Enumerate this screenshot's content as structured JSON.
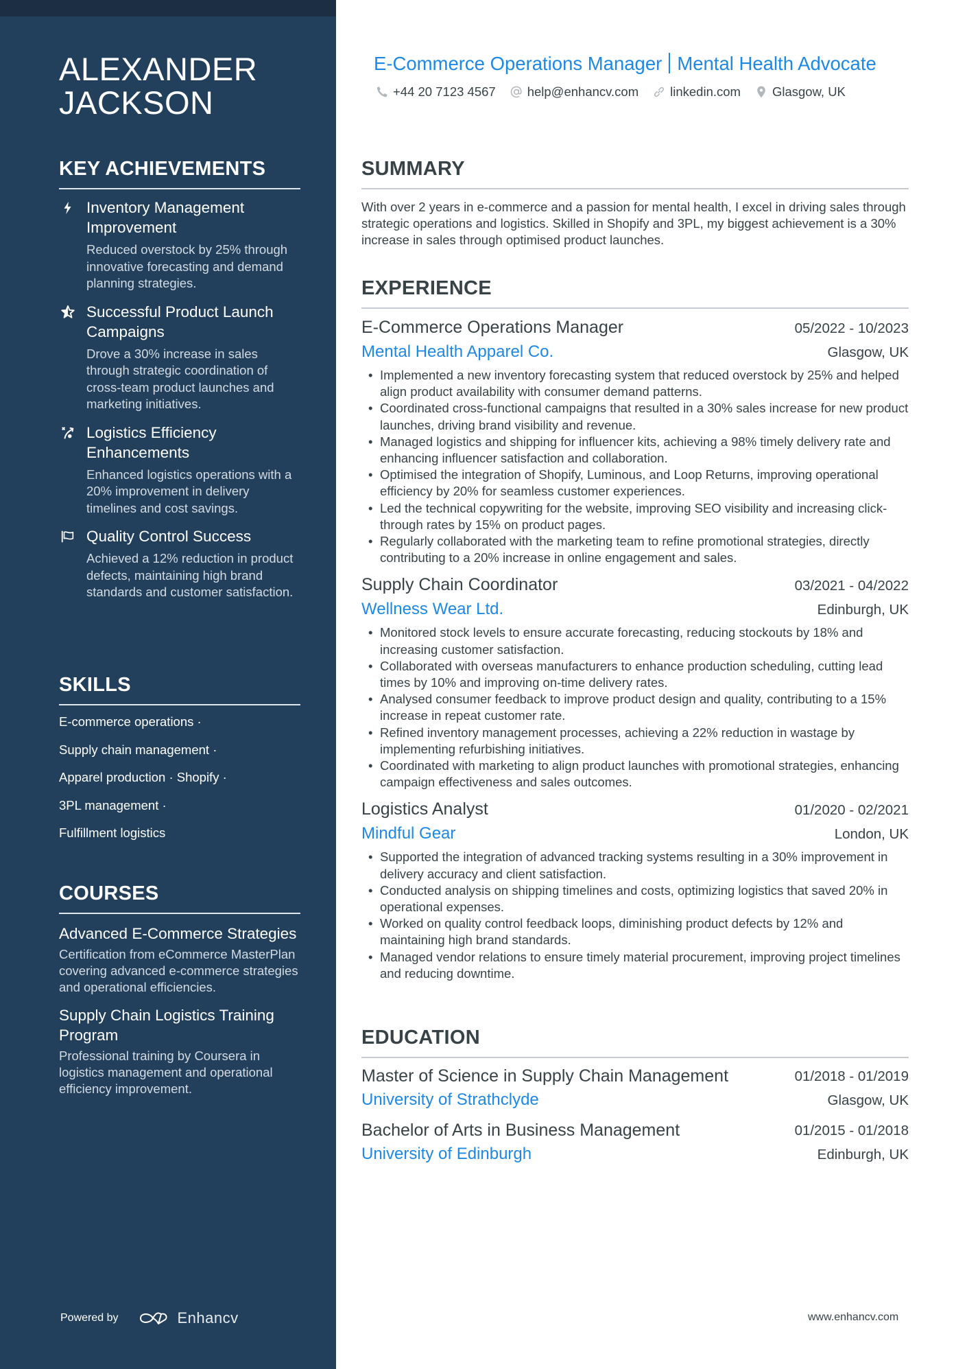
{
  "colors": {
    "sidebar_bg": "#223f5b",
    "sidebar_band": "#1b2e44",
    "accent": "#1e88e5",
    "text": "#384347"
  },
  "person": {
    "name_line1": "ALEXANDER",
    "name_line2": "JACKSON",
    "headline_part1": "E-Commerce Operations Manager",
    "headline_part2": "Mental Health Advocate"
  },
  "contact": {
    "phone": {
      "icon": "phone-icon",
      "text": "+44 20 7123 4567"
    },
    "email": {
      "icon": "at-icon",
      "text": "help@enhancv.com"
    },
    "linkedin": {
      "icon": "link-icon",
      "text": "linkedin.com"
    },
    "location": {
      "icon": "map-pin-icon",
      "text": "Glasgow, UK"
    }
  },
  "sidebar": {
    "achievements": {
      "title": "KEY ACHIEVEMENTS",
      "items": [
        {
          "icon": "lightning-bolt-icon",
          "title": "Inventory Management Improvement",
          "desc": "Reduced overstock by 25% through innovative forecasting and demand planning strategies."
        },
        {
          "icon": "star-icon",
          "title": "Successful Product Launch Campaigns",
          "desc": "Drove a 30% increase in sales through strategic coordination of cross-team product launches and marketing initiatives."
        },
        {
          "icon": "route-icon",
          "title": "Logistics Efficiency Enhancements",
          "desc": "Enhanced logistics operations with a 20% improvement in delivery timelines and cost savings."
        },
        {
          "icon": "flag-icon",
          "title": "Quality Control Success",
          "desc": "Achieved a 12% reduction in product defects, maintaining high brand standards and customer satisfaction."
        }
      ]
    },
    "skills": {
      "title": "SKILLS",
      "lines": [
        "E-commerce operations ·",
        "Supply chain management ·",
        "Apparel production · Shopify ·",
        "3PL management ·",
        "Fulfillment logistics"
      ]
    },
    "courses": {
      "title": "COURSES",
      "items": [
        {
          "title": "Advanced E-Commerce Strategies",
          "desc": "Certification from eCommerce MasterPlan covering advanced e-commerce strategies and operational efficiencies."
        },
        {
          "title": "Supply Chain Logistics Training Program",
          "desc": "Professional training by Coursera in logistics management and operational efficiency improvement."
        }
      ]
    },
    "powered_by": "Powered by",
    "brand": "Enhancv"
  },
  "summary": {
    "title": "SUMMARY",
    "text": "With over 2 years in e-commerce and a passion for mental health, I excel in driving sales through strategic operations and logistics. Skilled in Shopify and 3PL, my biggest achievement is a 30% increase in sales through optimised product launches."
  },
  "experience": {
    "title": "EXPERIENCE",
    "jobs": [
      {
        "role": "E-Commerce Operations Manager",
        "dates": "05/2022 - 10/2023",
        "company": "Mental Health Apparel Co.",
        "location": "Glasgow, UK",
        "bullets": [
          "Implemented a new inventory forecasting system that reduced overstock by 25% and helped align product availability with consumer demand patterns.",
          "Coordinated cross-functional campaigns that resulted in a 30% sales increase for new product launches, driving brand visibility and revenue.",
          "Managed logistics and shipping for influencer kits, achieving a 98% timely delivery rate and enhancing influencer satisfaction and collaboration.",
          "Optimised the integration of Shopify, Luminous, and Loop Returns, improving operational efficiency by 20% for seamless customer experiences.",
          "Led the technical copywriting for the website, improving SEO visibility and increasing click-through rates by 15% on product pages.",
          "Regularly collaborated with the marketing team to refine promotional strategies, directly contributing to a 20% increase in online engagement and sales."
        ]
      },
      {
        "role": "Supply Chain Coordinator",
        "dates": "03/2021 - 04/2022",
        "company": "Wellness Wear Ltd.",
        "location": "Edinburgh, UK",
        "bullets": [
          "Monitored stock levels to ensure accurate forecasting, reducing stockouts by 18% and increasing customer satisfaction.",
          "Collaborated with overseas manufacturers to enhance production scheduling, cutting lead times by 10% and improving on-time delivery rates.",
          "Analysed consumer feedback to improve product design and quality, contributing to a 15% increase in repeat customer rate.",
          "Refined inventory management processes, achieving a 22% reduction in wastage by implementing refurbishing initiatives.",
          "Coordinated with marketing to align product launches with promotional strategies, enhancing campaign effectiveness and sales outcomes."
        ]
      },
      {
        "role": "Logistics Analyst",
        "dates": "01/2020 - 02/2021",
        "company": "Mindful Gear",
        "location": "London, UK",
        "bullets": [
          "Supported the integration of advanced tracking systems resulting in a 30% improvement in delivery accuracy and client satisfaction.",
          "Conducted analysis on shipping timelines and costs, optimizing logistics that saved 20% in operational expenses.",
          "Worked on quality control feedback loops, diminishing product defects by 12% and maintaining high brand standards.",
          "Managed vendor relations to ensure timely material procurement, improving project timelines and reducing downtime."
        ]
      }
    ]
  },
  "education": {
    "title": "EDUCATION",
    "items": [
      {
        "degree": "Master of Science in Supply Chain Management",
        "dates": "01/2018 - 01/2019",
        "school": "University of Strathclyde",
        "location": "Glasgow, UK"
      },
      {
        "degree": "Bachelor of Arts in Business Management",
        "dates": "01/2015 - 01/2018",
        "school": "University of Edinburgh",
        "location": "Edinburgh, UK"
      }
    ]
  },
  "footer": {
    "url": "www.enhancv.com"
  }
}
